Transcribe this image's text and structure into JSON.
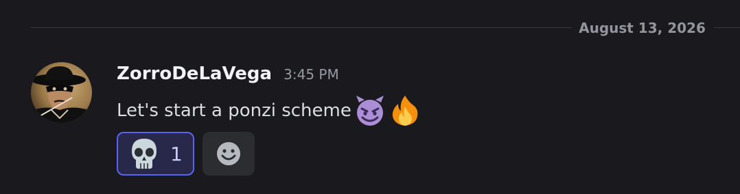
{
  "date_divider": {
    "label": "August 13, 2026"
  },
  "message": {
    "author": "ZorroDeLaVega",
    "timestamp": "3:45 PM",
    "text": "Let's start a ponzi scheme",
    "emojis": [
      "smiling-imp-emoji",
      "fire-emoji"
    ],
    "avatar_icon": "zorro-avatar"
  },
  "reactions": [
    {
      "emoji": "skull-emoji",
      "count": "1",
      "active": true
    }
  ],
  "add_reaction": {
    "icon": "add-reaction-icon"
  },
  "colors": {
    "background": "#1a1a1e",
    "divider": "#3a3b40",
    "accent": "#5865f2",
    "active_reaction_bg": "#27284a",
    "timestamp": "#949ba4"
  }
}
